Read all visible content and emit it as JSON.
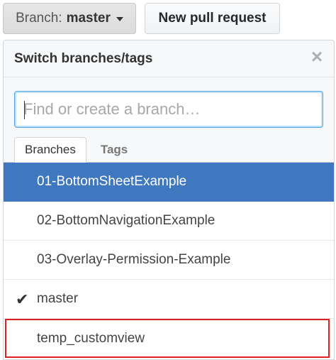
{
  "top_bar": {
    "branch_label": "Branch:",
    "branch_value": "master",
    "new_pull_request": "New pull request"
  },
  "dropdown": {
    "title": "Switch branches/tags",
    "close_glyph": "×",
    "search_placeholder": "Find or create a branch…",
    "tabs": [
      {
        "label": "Branches",
        "active": true
      },
      {
        "label": "Tags",
        "active": false
      }
    ],
    "branches": [
      {
        "name": "01-BottomSheetExample",
        "selected": true
      },
      {
        "name": "02-BottomNavigationExample"
      },
      {
        "name": "03-Overlay-Permission-Example"
      },
      {
        "name": "master",
        "current": true,
        "check_glyph": "✔"
      },
      {
        "name": "temp_customview",
        "highlighted": true
      }
    ]
  },
  "colors": {
    "selected_row": "#4078c0",
    "highlight_border": "#e02020",
    "input_focus": "#51a7e8"
  }
}
